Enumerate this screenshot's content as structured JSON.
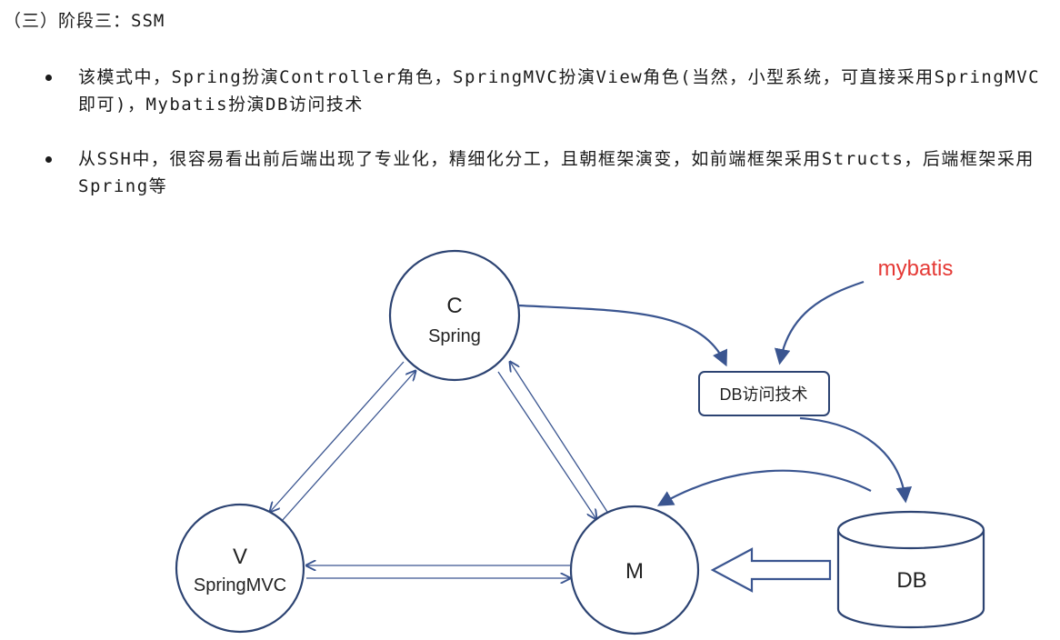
{
  "heading": "（三）阶段三：SSM",
  "bullets": [
    {
      "text": "该模式中，Spring扮演Controller角色，SpringMVC扮演View角色(当然，小型系统，可直接采用SpringMVC即可)，Mybatis扮演DB访问技术"
    },
    {
      "text": "从SSH中，很容易看出前后端出现了专业化，精细化分工，且朝框架演变，如前端框架采用Structs，后端框架采用Spring等"
    }
  ],
  "diagram": {
    "node_c": {
      "letter": "C",
      "sub": "Spring"
    },
    "node_v": {
      "letter": "V",
      "sub": "SpringMVC"
    },
    "node_m": {
      "letter": "M"
    },
    "db_box": {
      "label": "DB访问技术"
    },
    "db_cylinder": {
      "label": "DB"
    },
    "mybatis_label": "mybatis",
    "colors": {
      "line": "#3a5590",
      "accent": "#e53935"
    }
  }
}
